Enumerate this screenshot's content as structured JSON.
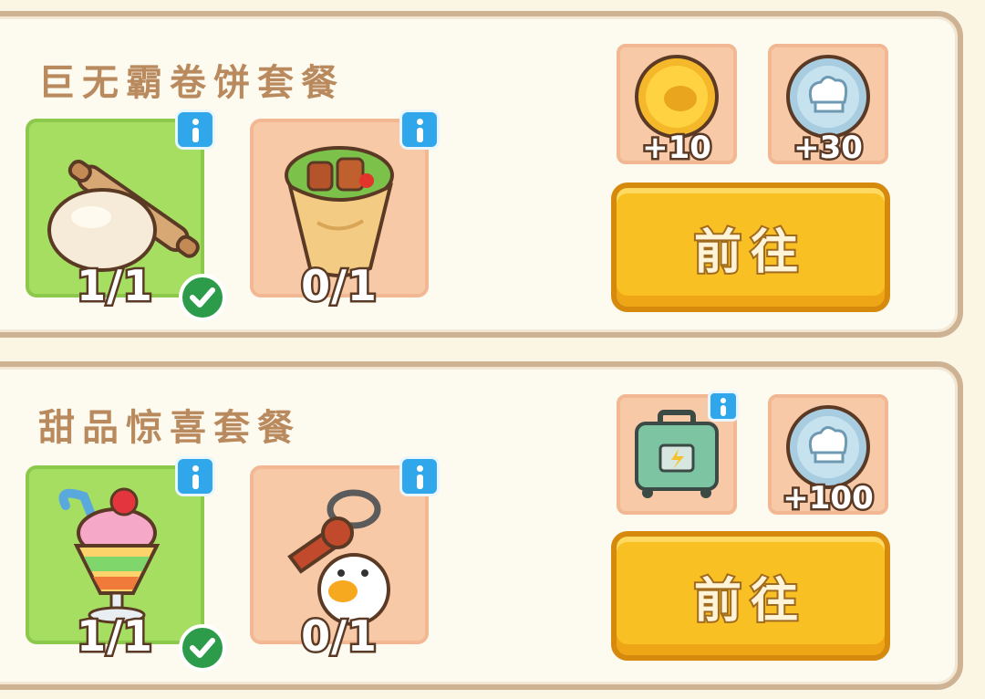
{
  "tasks": [
    {
      "title": "巨无霸卷饼套餐",
      "items": [
        {
          "name": "dough",
          "progress": "1/1",
          "complete": true
        },
        {
          "name": "burrito",
          "progress": "0/1",
          "complete": false
        }
      ],
      "rewards": [
        {
          "icon": "gold-coin-icon",
          "amount": "+10"
        },
        {
          "icon": "chef-coin-icon",
          "amount": "+30"
        }
      ],
      "button_label": "前往"
    },
    {
      "title": "甜品惊喜套餐",
      "items": [
        {
          "name": "parfait",
          "progress": "1/1",
          "complete": true
        },
        {
          "name": "key-keychain",
          "progress": "0/1",
          "complete": false
        }
      ],
      "rewards": [
        {
          "icon": "energy-suitcase-icon",
          "amount": ""
        },
        {
          "icon": "chef-coin-icon",
          "amount": "+100"
        }
      ],
      "button_label": "前往"
    }
  ],
  "colors": {
    "complete_slot": "#a6de62",
    "pending_slot": "#f7c9a7",
    "button": "#f8c022",
    "check": "#2c9c4a",
    "info": "#2fa7ea"
  }
}
